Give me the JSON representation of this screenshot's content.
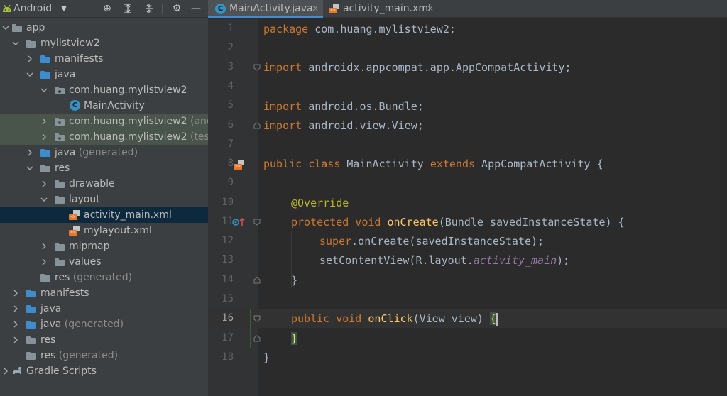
{
  "project_panel": {
    "view_selector": "Android",
    "tree": [
      {
        "label": "app",
        "gen": "",
        "icon": "module-folder-icon"
      },
      {
        "label": "mylistview2",
        "gen": "",
        "icon": "module-folder-icon"
      },
      {
        "label": "manifests",
        "gen": "",
        "icon": "folder-icon"
      },
      {
        "label": "java",
        "gen": "",
        "icon": "folder-icon"
      },
      {
        "label": "com.huang.mylistview2",
        "gen": "",
        "icon": "package-icon"
      },
      {
        "label": "MainActivity",
        "gen": "",
        "icon": "class-icon"
      },
      {
        "label": "com.huang.mylistview2",
        "gen": " (andro",
        "icon": "package-icon"
      },
      {
        "label": "com.huang.mylistview2",
        "gen": " (test)",
        "icon": "package-icon"
      },
      {
        "label": "java",
        "gen": " (generated)",
        "icon": "generated-folder-icon"
      },
      {
        "label": "res",
        "gen": "",
        "icon": "folder-icon"
      },
      {
        "label": "drawable",
        "gen": "",
        "icon": "folder-icon"
      },
      {
        "label": "layout",
        "gen": "",
        "icon": "folder-icon"
      },
      {
        "label": "activity_main.xml",
        "gen": "",
        "icon": "xml-layout-icon"
      },
      {
        "label": "mylayout.xml",
        "gen": "",
        "icon": "xml-layout-icon"
      },
      {
        "label": "mipmap",
        "gen": "",
        "icon": "folder-icon"
      },
      {
        "label": "values",
        "gen": "",
        "icon": "folder-icon"
      },
      {
        "label": "res",
        "gen": " (generated)",
        "icon": "folder-icon"
      },
      {
        "label": "manifests",
        "gen": "",
        "icon": "folder-icon"
      },
      {
        "label": "java",
        "gen": "",
        "icon": "folder-icon"
      },
      {
        "label": "java",
        "gen": " (generated)",
        "icon": "folder-icon"
      },
      {
        "label": "res",
        "gen": "",
        "icon": "folder-icon"
      },
      {
        "label": "res",
        "gen": " (generated)",
        "icon": "folder-icon"
      },
      {
        "label": "Gradle Scripts",
        "gen": "",
        "icon": "gradle-icon"
      }
    ]
  },
  "editor": {
    "tabs": [
      {
        "label": "MainActivity.java",
        "active": true
      },
      {
        "label": "activity_main.xml",
        "active": false
      }
    ],
    "line_numbers": [
      "1",
      "2",
      "3",
      "4",
      "5",
      "6",
      "7",
      "8",
      "9",
      "10",
      "11",
      "12",
      "13",
      "14",
      "15",
      "16",
      "17",
      "18"
    ],
    "current_line": 16,
    "code": {
      "l1_kw": "package",
      "l1_rest": " com.huang.mylistview2;",
      "l3_kw": "import",
      "l3_rest": " androidx.appcompat.app.AppCompatActivity;",
      "l5_kw": "import",
      "l5_rest": " android.os.Bundle;",
      "l6_kw": "import",
      "l6_rest": " android.view.View;",
      "l8_kw1": "public class",
      "l8_name": " MainActivity ",
      "l8_kw2": "extends",
      "l8_rest": " AppCompatActivity {",
      "l10_ann": "@Override",
      "l11_kw": "protected void",
      "l11_fn": "onCreate",
      "l11_rest": "(Bundle savedInstanceState) {",
      "l12_kw": "super",
      "l12_rest": ".onCreate(savedInstanceState);",
      "l13_pre": "setContentView(R.layout.",
      "l13_ital": "activity_main",
      "l13_post": ");",
      "l14": "}",
      "l16_kw": "public void",
      "l16_fn": "onClick",
      "l16_rest": "(View view) ",
      "l16_brace": "{",
      "l17": "}",
      "l18": "}"
    }
  },
  "colors": {
    "keyword": "#cc7832",
    "annotation": "#bbb529",
    "function": "#ffc66d",
    "field_italic": "#9876aa",
    "text": "#a9b7c6",
    "selection": "#0d293e"
  }
}
